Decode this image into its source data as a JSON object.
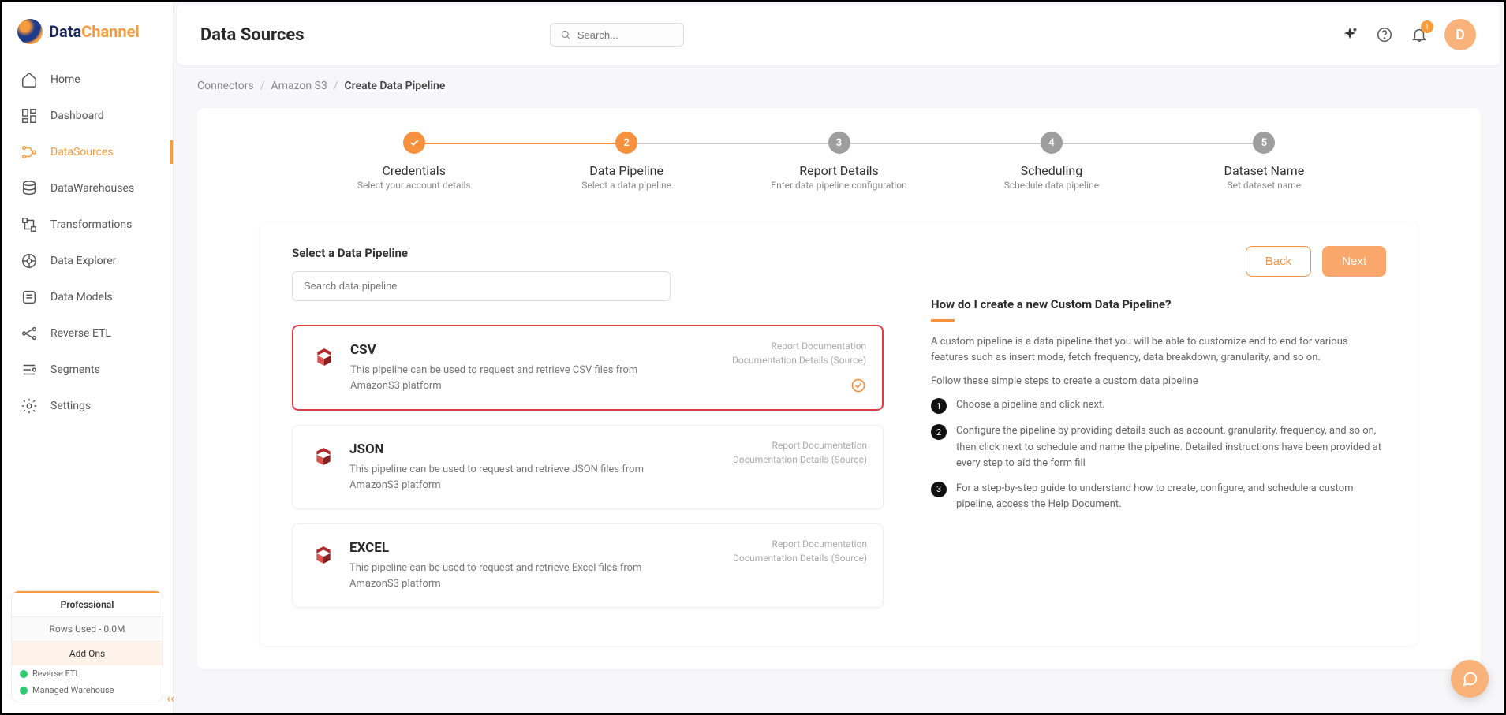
{
  "brand": {
    "part1": "Data",
    "part2": "Channel"
  },
  "header": {
    "title": "Data Sources",
    "search_placeholder": "Search...",
    "notif_count": "1",
    "avatar_initial": "D"
  },
  "sidebar": {
    "items": [
      {
        "label": "Home"
      },
      {
        "label": "Dashboard"
      },
      {
        "label": "DataSources"
      },
      {
        "label": "DataWarehouses"
      },
      {
        "label": "Transformations"
      },
      {
        "label": "Data Explorer"
      },
      {
        "label": "Data Models"
      },
      {
        "label": "Reverse ETL"
      },
      {
        "label": "Segments"
      },
      {
        "label": "Settings"
      }
    ],
    "plan": {
      "name": "Professional",
      "rows": "Rows Used - 0.0M",
      "addons": "Add Ons",
      "status1": "Reverse ETL",
      "status2": "Managed Warehouse"
    }
  },
  "breadcrumbs": {
    "a": "Connectors",
    "b": "Amazon S3",
    "c": "Create Data Pipeline"
  },
  "steps": [
    {
      "num": "✓",
      "title": "Credentials",
      "sub": "Select your account details"
    },
    {
      "num": "2",
      "title": "Data Pipeline",
      "sub": "Select a data pipeline"
    },
    {
      "num": "3",
      "title": "Report Details",
      "sub": "Enter data pipeline configuration"
    },
    {
      "num": "4",
      "title": "Scheduling",
      "sub": "Schedule data pipeline"
    },
    {
      "num": "5",
      "title": "Dataset Name",
      "sub": "Set dataset name"
    }
  ],
  "pipeline_section": {
    "title": "Select a Data Pipeline",
    "search_placeholder": "Search data pipeline",
    "back": "Back",
    "next": "Next",
    "link1": "Report Documentation",
    "link2": "Documentation Details (Source)",
    "items": [
      {
        "title": "CSV",
        "desc": "This pipeline can be used to request and retrieve CSV files from AmazonS3 platform"
      },
      {
        "title": "JSON",
        "desc": "This pipeline can be used to request and retrieve JSON files from AmazonS3 platform"
      },
      {
        "title": "EXCEL",
        "desc": "This pipeline can be used to request and retrieve Excel files from AmazonS3 platform"
      }
    ]
  },
  "help": {
    "title": "How do I create a new Custom Data Pipeline?",
    "p1": "A custom pipeline is a data pipeline that you will be able to customize end to end for various features such as insert mode, fetch frequency, data breakdown, granularity, and so on.",
    "p2": "Follow these simple steps to create a custom data pipeline",
    "steps": [
      "Choose a pipeline and click next.",
      "Configure the pipeline by providing details such as account, granularity, frequency, and so on, then click next to schedule and name the pipeline. Detailed instructions have been provided at every step to aid the form fill",
      "For a step-by-step guide to understand how to create, configure, and schedule a custom pipeline, access the Help Document."
    ]
  }
}
